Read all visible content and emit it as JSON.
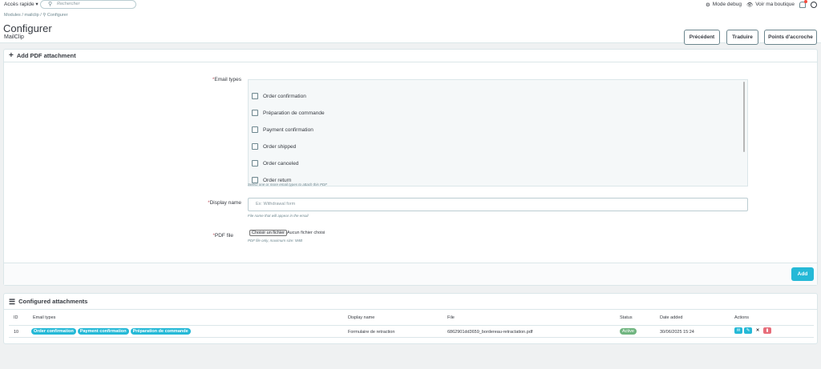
{
  "topbar": {
    "quick_access": "Accès rapide ▾",
    "search_placeholder": "Rechercher",
    "debug": "Mode debug",
    "view_shop": "Voir ma boutique"
  },
  "header": {
    "breadcrumb": "Modules / mailclip / ⚲ Configurer",
    "title": "Configurer",
    "subtitle": "MailClip",
    "buttons": {
      "previous": "Précédent",
      "translate": "Traduire",
      "hooks": "Points d'accroche"
    }
  },
  "form": {
    "section_title": "Add PDF attachment",
    "email_types_label": "Email types",
    "email_types": [
      "Order confirmation",
      "Préparation de commande",
      "Payment confirmation",
      "Order shipped",
      "Order canceled",
      "Order return"
    ],
    "email_types_help": "Select one or more email types to attach this PDF",
    "display_name_label": "Display name",
    "display_name_placeholder": "Ex: Withdrawal form",
    "display_name_help": "File name that will appear in the email",
    "pdf_label": "PDF file",
    "file_button": "Choisir un fichier",
    "file_none": "Aucun fichier choisi",
    "pdf_help": "PDF file only, maximum size: 5MB",
    "add_button": "Add",
    "required_mark": "*"
  },
  "table": {
    "section_title": "Configured attachments",
    "headers": {
      "id": "ID",
      "types": "Email types",
      "name": "Display name",
      "file": "File",
      "status": "Status",
      "date": "Date added",
      "actions": "Actions"
    },
    "rows": [
      {
        "id": "10",
        "types": [
          "Order confirmation",
          "Payment confirmation",
          "Préparation de commande"
        ],
        "name": "Formulaire de retraction",
        "file": "6862901dd3659_bordereau-retractation.pdf",
        "status": "Active",
        "date": "30/06/2025 15:24"
      }
    ]
  },
  "colors": {
    "accent": "#25b9d7",
    "success": "#70b580",
    "danger": "#e76d7a",
    "background": "#eff1f2"
  },
  "icons": {
    "search": "search-icon",
    "debug": "gear-icon",
    "view_shop": "eye-icon",
    "notifications": "bell-icon",
    "user": "user-icon",
    "add": "plus-icon",
    "list": "list-icon",
    "send": "envelope-icon",
    "edit": "pencil-icon",
    "toggle": "close-icon",
    "delete": "trash-icon"
  }
}
